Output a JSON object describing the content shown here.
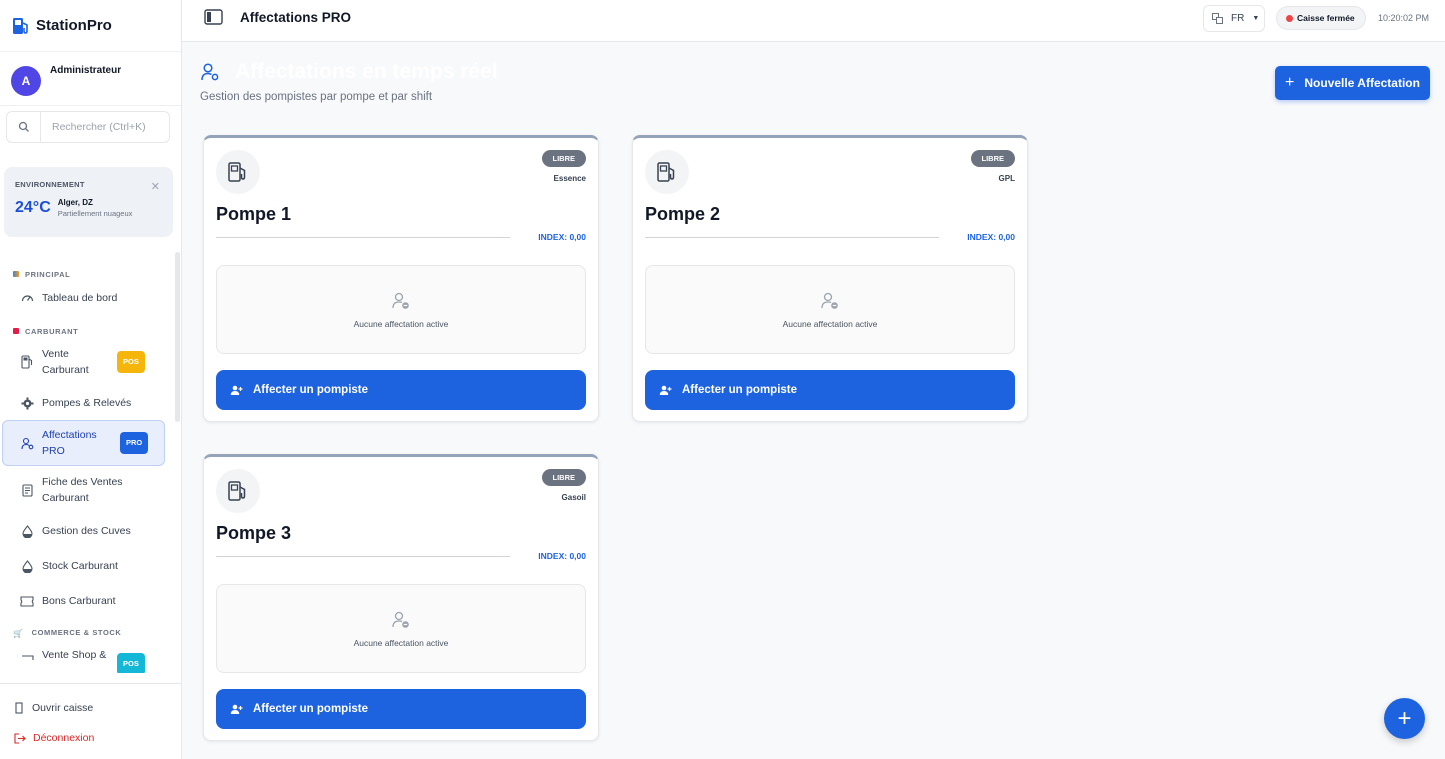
{
  "app": {
    "name": "StationPro"
  },
  "user": {
    "initial": "A",
    "name": "Administrateur"
  },
  "search": {
    "placeholder": "Rechercher (Ctrl+K)"
  },
  "environment": {
    "label": "ENVIRONNEMENT",
    "temperature": "24°C",
    "city": "Alger, DZ",
    "condition": "Partiellement nuageux"
  },
  "nav": {
    "sections": {
      "principal": "PRINCIPAL",
      "carburant": "CARBURANT",
      "commerce": "COMMERCE & STOCK"
    },
    "items": {
      "tableau": "Tableau de bord",
      "vente_carburant": "Vente Carburant",
      "vente_badge": "POS",
      "pompes": "Pompes & Relevés",
      "affectations": "Affectations PRO",
      "affectations_badge": "PRO",
      "fiche": "Fiche des Ventes Carburant",
      "cuves": "Gestion des Cuves",
      "stock": "Stock Carburant",
      "bons": "Bons Carburant",
      "vente_shop": "Vente Shop &",
      "vente_shop_badge": "POS"
    },
    "bottom": {
      "ouvrir": "Ouvrir caisse",
      "deconnexion": "Déconnexion"
    }
  },
  "topbar": {
    "title": "Affectations PRO",
    "lang": "FR",
    "caisse": "Caisse fermée",
    "time": "10:20:02 PM"
  },
  "page": {
    "title": "Affectations en temps réel",
    "subtitle": "Gestion des pompistes par pompe et par shift",
    "new_button": "Nouvelle Affectation"
  },
  "pumps": [
    {
      "name": "Pompe 1",
      "status": "LIBRE",
      "fuel": "Essence",
      "index": "INDEX: 0,00",
      "empty": "Aucune affectation active",
      "action": "Affecter un pompiste"
    },
    {
      "name": "Pompe 2",
      "status": "LIBRE",
      "fuel": "GPL",
      "index": "INDEX: 0,00",
      "empty": "Aucune affectation active",
      "action": "Affecter un pompiste"
    },
    {
      "name": "Pompe 3",
      "status": "LIBRE",
      "fuel": "Gasoil",
      "index": "INDEX: 0,00",
      "empty": "Aucune affectation active",
      "action": "Affecter un pompiste"
    }
  ],
  "colors": {
    "accent": "#1d63e0",
    "status_closed": "#ef4444",
    "pos_badge": "#f5b50a"
  }
}
